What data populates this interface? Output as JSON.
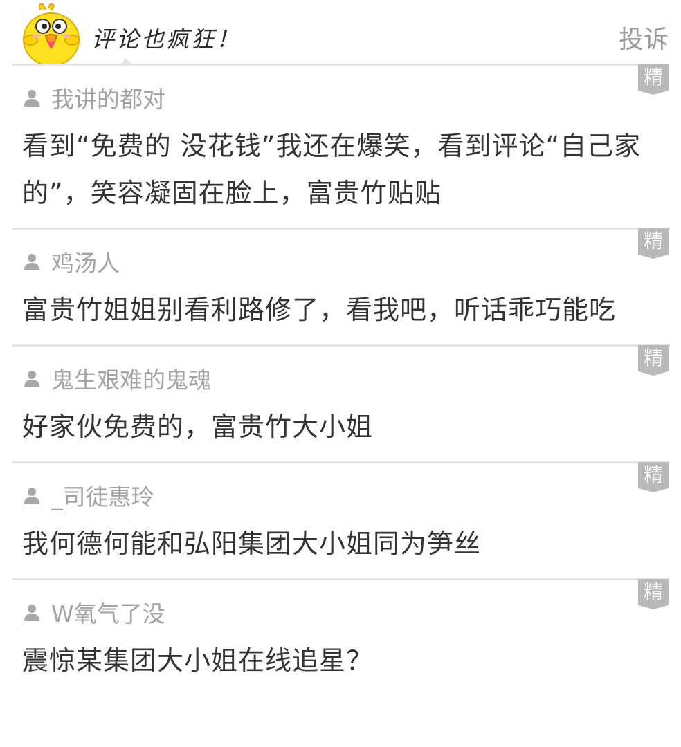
{
  "header": {
    "title": "评论也疯狂！",
    "report_label": "投诉",
    "mascot_icon": "yellow-chick-mascot"
  },
  "badge_label": "精",
  "comments": [
    {
      "author": "我讲的都对",
      "text": "看到“免费的 没花钱”我还在爆笑，看到评论“自己家的”，笑容凝固在脸上，富贵竹贴贴"
    },
    {
      "author": "鸡汤人",
      "text": "富贵竹姐姐别看利路修了，看我吧，听话乖巧能吃"
    },
    {
      "author": "鬼生艰难的鬼魂",
      "text": "好家伙免费的，富贵竹大小姐"
    },
    {
      "author": "_司徒惠玲",
      "text": "我何德何能和弘阳集团大小姐同为笋丝"
    },
    {
      "author": "W氧气了没",
      "text": "震惊某集团大小姐在线追星？"
    }
  ],
  "colors": {
    "divider": "#e6e6e6",
    "badge": "#b9b9b9",
    "author": "#a3a3a3",
    "text": "#333333",
    "report": "#9a9a9a"
  }
}
